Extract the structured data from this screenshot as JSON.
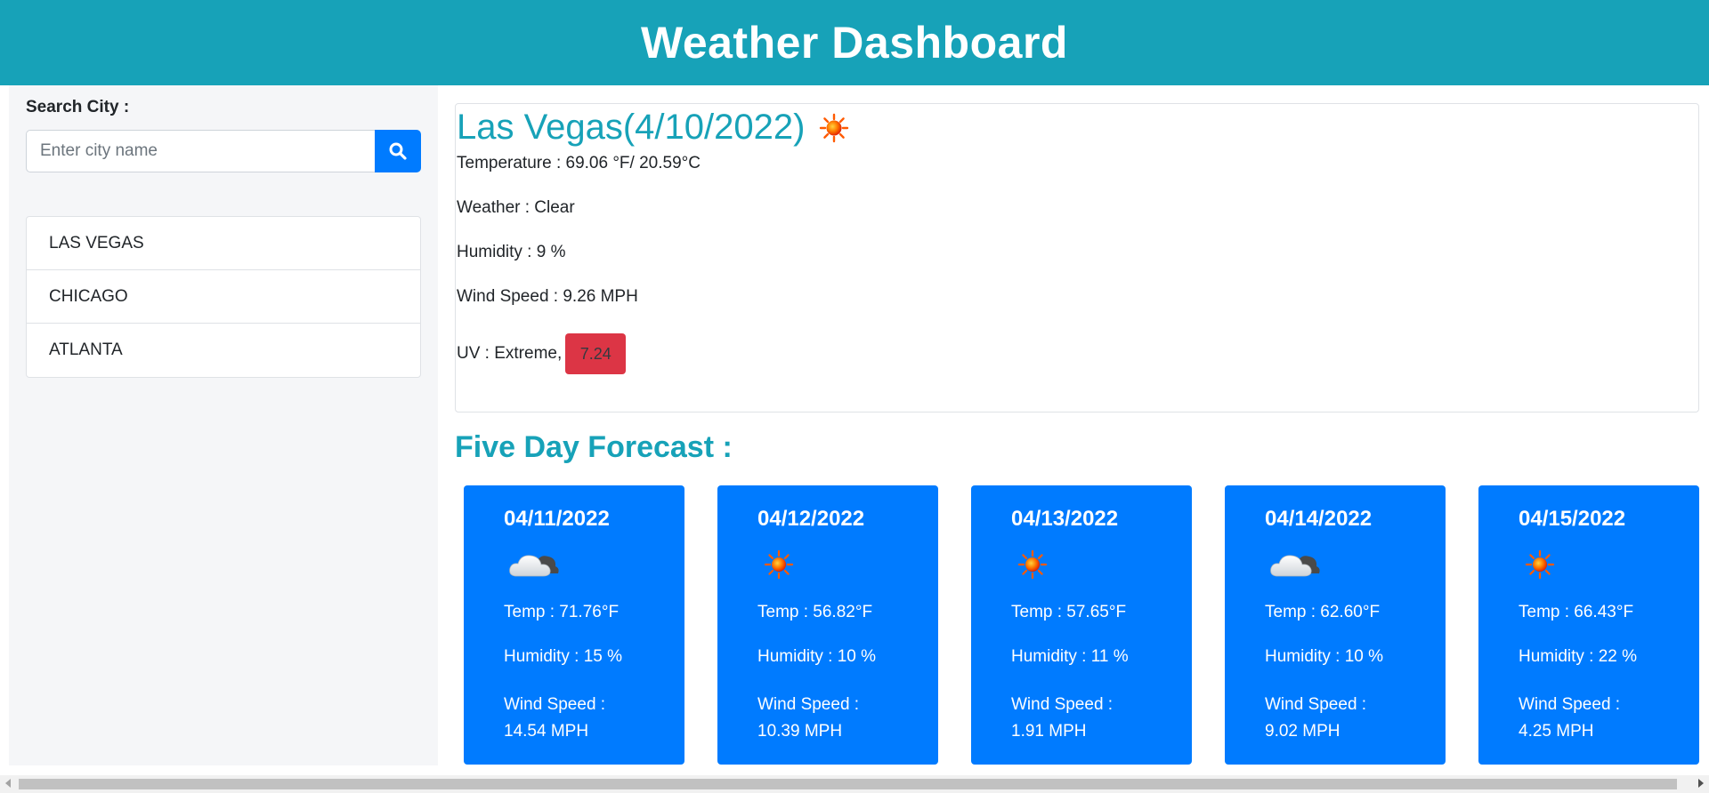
{
  "header": {
    "title": "Weather Dashboard"
  },
  "search": {
    "label": "Search City :",
    "placeholder": "Enter city name",
    "button_icon": "search-icon"
  },
  "history": [
    "LAS VEGAS",
    "CHICAGO",
    "ATLANTA"
  ],
  "current": {
    "title": "Las Vegas(4/10/2022)",
    "icon": "sun-icon",
    "temperature": "Temperature : 69.06 °F/ 20.59°C",
    "weather": "Weather : Clear",
    "humidity": "Humidity : 9 %",
    "wind": "Wind Speed : 9.26 MPH",
    "uv_label": "UV : Extreme,",
    "uv_value": "7.24",
    "uv_color": "#dc3545"
  },
  "forecast": {
    "title": "Five Day Forecast :",
    "days": [
      {
        "date": "04/11/2022",
        "icon": "cloud-icon",
        "temp": "Temp : 71.76°F",
        "humidity": "Humidity : 15 %",
        "wind_label": "Wind Speed :",
        "wind_value": "14.54 MPH"
      },
      {
        "date": "04/12/2022",
        "icon": "sun-icon",
        "temp": "Temp : 56.82°F",
        "humidity": "Humidity : 10 %",
        "wind_label": "Wind Speed :",
        "wind_value": "10.39 MPH"
      },
      {
        "date": "04/13/2022",
        "icon": "sun-icon",
        "temp": "Temp : 57.65°F",
        "humidity": "Humidity : 11 %",
        "wind_label": "Wind Speed :",
        "wind_value": "1.91 MPH"
      },
      {
        "date": "04/14/2022",
        "icon": "cloud-icon",
        "temp": "Temp : 62.60°F",
        "humidity": "Humidity : 10 %",
        "wind_label": "Wind Speed :",
        "wind_value": "9.02 MPH"
      },
      {
        "date": "04/15/2022",
        "icon": "sun-icon",
        "temp": "Temp : 66.43°F",
        "humidity": "Humidity : 22 %",
        "wind_label": "Wind Speed :",
        "wind_value": "4.25 MPH"
      }
    ]
  },
  "colors": {
    "header_bg": "#17a2b8",
    "accent_text": "#17a2b8",
    "card_bg": "#007bff",
    "button_bg": "#007bff"
  }
}
